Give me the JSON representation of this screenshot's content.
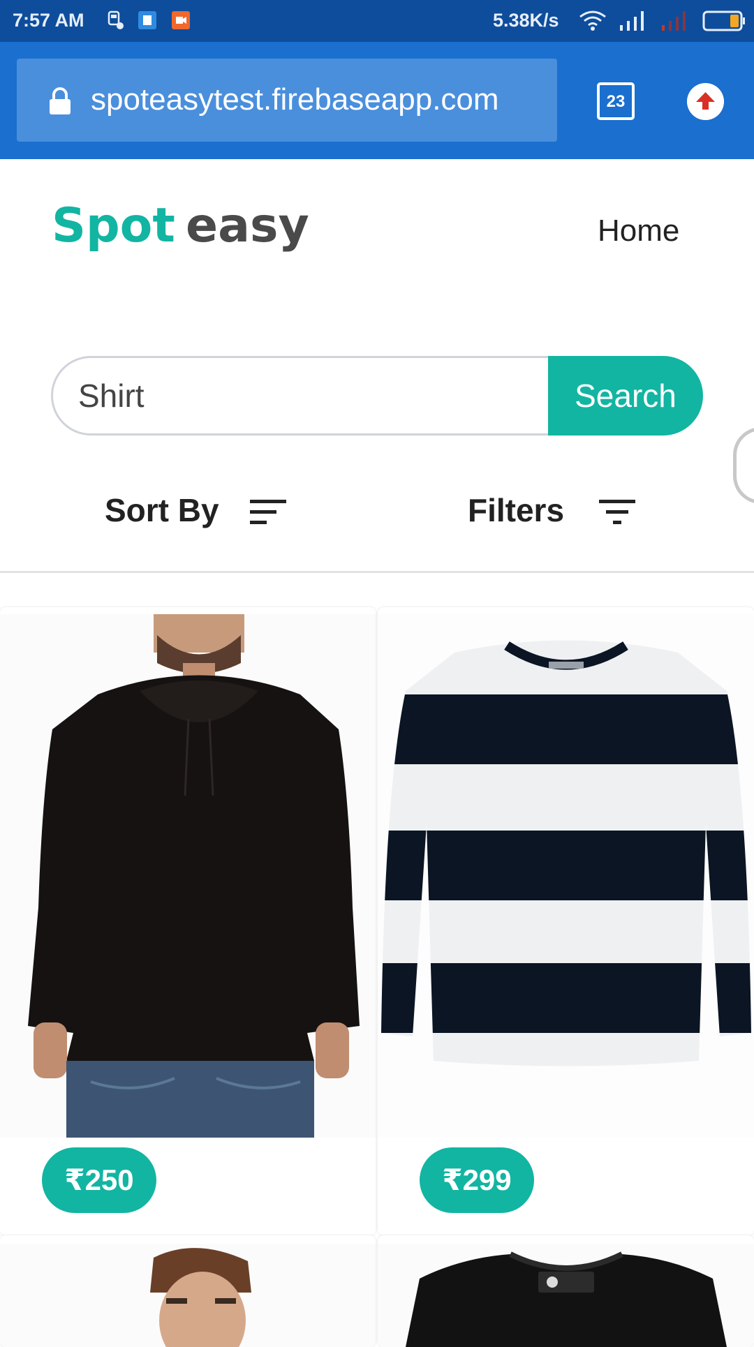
{
  "status_bar": {
    "time": "7:57 AM",
    "network_speed": "5.38K/s",
    "icons": [
      "train-icon",
      "notification-icon",
      "video-icon",
      "wifi-icon",
      "signal-icon",
      "signal-weak-icon",
      "battery-icon"
    ]
  },
  "browser": {
    "url": "spoteasytest.firebaseapp.com",
    "tab_count": "23",
    "icons": [
      "lock-icon",
      "update-icon"
    ]
  },
  "header": {
    "logo_part1": "Spot",
    "logo_part2": "easy",
    "nav_home": "Home"
  },
  "search": {
    "value": "Shirt",
    "button_label": "Search"
  },
  "controls": {
    "sort_label": "Sort By",
    "filter_label": "Filters"
  },
  "products": [
    {
      "price": "₹250"
    },
    {
      "price": "₹299"
    }
  ],
  "colors": {
    "accent": "#12b5a2",
    "browser_bar": "#1a6fcf",
    "status_bar": "#0e4d9c",
    "logo_dark": "#4a4a4a"
  }
}
